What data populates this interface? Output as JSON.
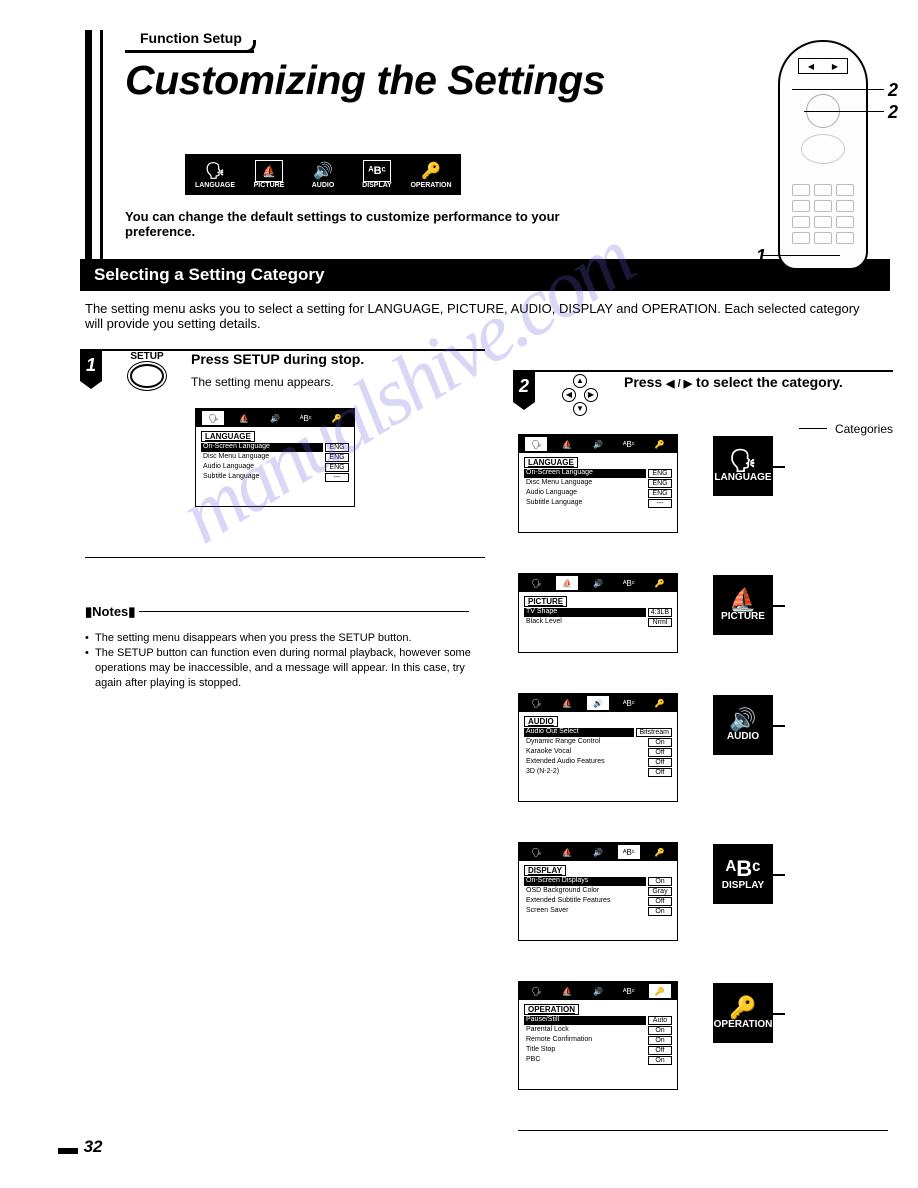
{
  "header": {
    "function_setup": "Function Setup",
    "title": "Customizing the Settings",
    "icons": [
      "LANGUAGE",
      "PICTURE",
      "AUDIO",
      "DISPLAY",
      "OPERATION"
    ],
    "intro": "You can change the default settings to customize performance to your preference."
  },
  "remote_callouts": {
    "c1": "1",
    "c2a": "2",
    "c2b": "2"
  },
  "section": {
    "title": "Selecting a Setting Category",
    "intro": "The setting menu asks you to select a setting for LANGUAGE, PICTURE, AUDIO, DISPLAY and OPERATION. Each selected category will provide you setting details."
  },
  "step1": {
    "num": "1",
    "button_label": "SETUP",
    "title": "Press SETUP during stop.",
    "sub": "The setting menu appears.",
    "screen": {
      "category": "LANGUAGE",
      "rows": [
        {
          "l": "On-Screen Language",
          "v": "ENG",
          "hl": true
        },
        {
          "l": "Disc Menu Language",
          "v": "ENG"
        },
        {
          "l": "Audio Language",
          "v": "ENG"
        },
        {
          "l": "Subtitle Language",
          "v": "---"
        }
      ]
    }
  },
  "step2": {
    "num": "2",
    "title_pre": "Press ",
    "title_post": " to select the category.",
    "arrows": "◀ / ▶",
    "categories_label": "Categories"
  },
  "cat_screens": [
    {
      "icon_label": "LANGUAGE",
      "icon_sym": "🗣",
      "category": "LANGUAGE",
      "rows": [
        {
          "l": "On-Screen Language",
          "v": "ENG",
          "hl": true
        },
        {
          "l": "Disc Menu Language",
          "v": "ENG"
        },
        {
          "l": "Audio Language",
          "v": "ENG"
        },
        {
          "l": "Subtitle Language",
          "v": "---"
        }
      ],
      "sel": 0
    },
    {
      "icon_label": "PICTURE",
      "icon_sym": "⛵",
      "category": "PICTURE",
      "rows": [
        {
          "l": "TV Shape",
          "v": "4:3LB",
          "hl": true
        },
        {
          "l": "Black Level",
          "v": "Nrml"
        }
      ],
      "sel": 1
    },
    {
      "icon_label": "AUDIO",
      "icon_sym": "🔊",
      "category": "AUDIO",
      "rows": [
        {
          "l": "Audio Out Select",
          "v": "Bitstream",
          "hl": true
        },
        {
          "l": "Dynamic Range Control",
          "v": "On"
        },
        {
          "l": "Karaoke Vocal",
          "v": "Off"
        },
        {
          "l": "Extended Audio Features",
          "v": "Off"
        },
        {
          "l": "3D (N-2-2)",
          "v": "Off"
        }
      ],
      "sel": 2
    },
    {
      "icon_label": "DISPLAY",
      "icon_sym": "ᴬBᶜ",
      "category": "DISPLAY",
      "rows": [
        {
          "l": "On-Screen Displays",
          "v": "On",
          "hl": true
        },
        {
          "l": "OSD Background Color",
          "v": "Gray"
        },
        {
          "l": "Extended Subtitle Features",
          "v": "Off"
        },
        {
          "l": "Screen Saver",
          "v": "On"
        }
      ],
      "sel": 3
    },
    {
      "icon_label": "OPERATION",
      "icon_sym": "🔑",
      "category": "OPERATION",
      "rows": [
        {
          "l": "Pause/Still",
          "v": "Auto",
          "hl": true
        },
        {
          "l": "Parental Lock",
          "v": "On"
        },
        {
          "l": "Remote Confirmation",
          "v": "On"
        },
        {
          "l": "Title Stop",
          "v": "Off"
        },
        {
          "l": "PBC",
          "v": "On"
        }
      ],
      "sel": 4
    }
  ],
  "notes": {
    "label": "Notes",
    "items": [
      "The setting menu disappears when you press the SETUP button.",
      "The SETUP button can function even during normal playback, however some operations may be inaccessible, and a message will appear. In this case, try again after playing is stopped."
    ]
  },
  "page_number": "32",
  "watermark": "manualshive.com"
}
